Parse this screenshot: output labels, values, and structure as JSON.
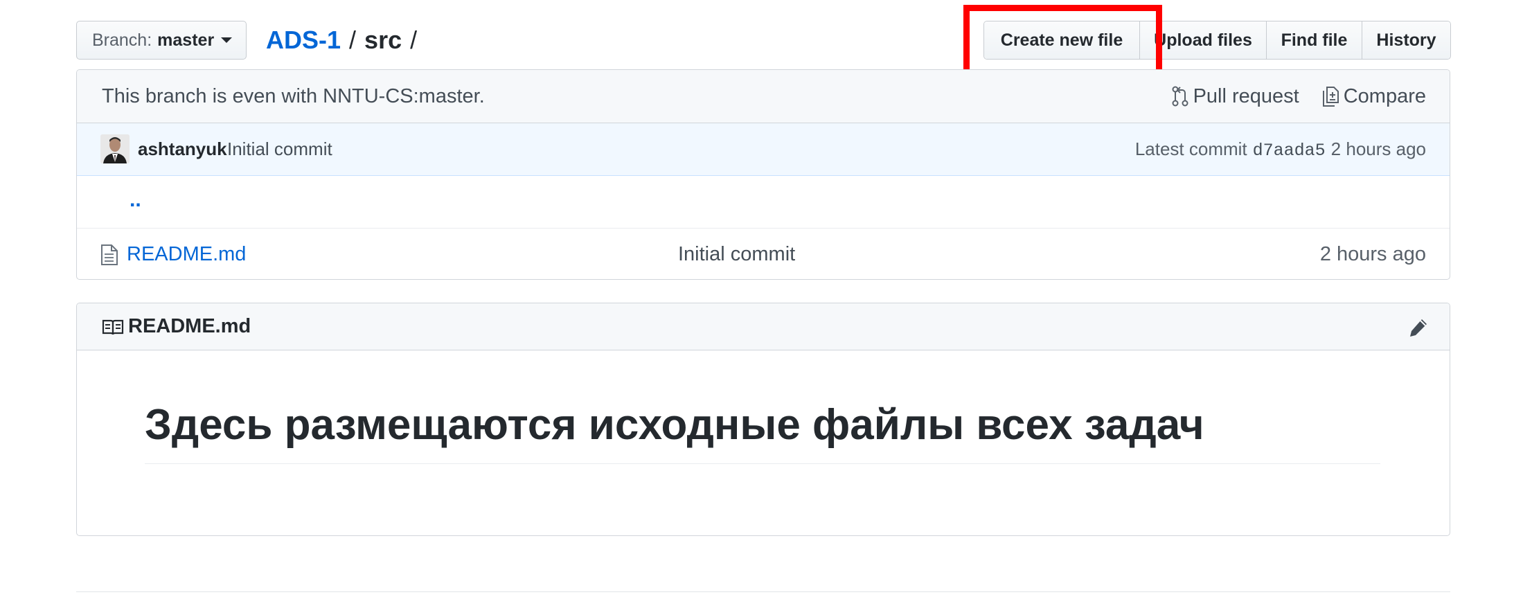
{
  "branch_selector": {
    "prefix": "Branch:",
    "name": "master"
  },
  "breadcrumb": {
    "repo": "ADS-1",
    "separator": "/",
    "dir": "src",
    "trailing": "/"
  },
  "file_actions": {
    "create_new_file": "Create new file",
    "upload_files": "Upload files",
    "find_file": "Find file",
    "history": "History"
  },
  "branch_info": {
    "message": "This branch is even with NNTU-CS:master.",
    "pull_request": "Pull request",
    "compare": "Compare"
  },
  "latest_commit": {
    "author": "ashtanyuk",
    "message": "Initial commit",
    "label": "Latest commit",
    "sha": "d7aada5",
    "age": "2 hours ago"
  },
  "files": {
    "up_link": "..",
    "rows": [
      {
        "name": "README.md",
        "message": "Initial commit",
        "age": "2 hours ago"
      }
    ]
  },
  "readme": {
    "title": "README.md",
    "heading": "Здесь размещаются исходные файлы всех задач"
  },
  "colors": {
    "link": "#0366d6",
    "highlight": "#ff0000",
    "commit_bar_bg": "#f1f8ff",
    "box_header_bg": "#f6f8fa"
  }
}
